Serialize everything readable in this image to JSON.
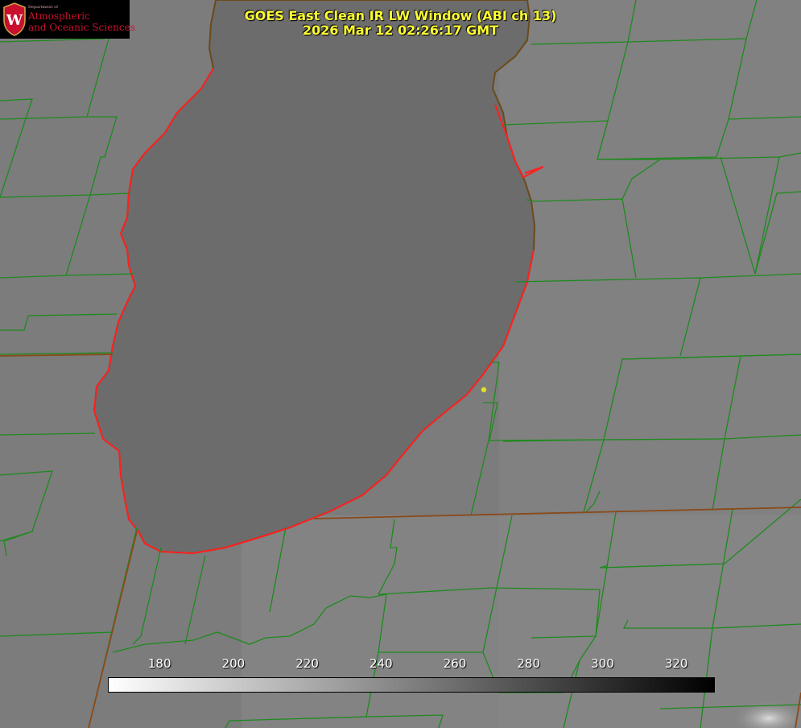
{
  "title": {
    "line1": "GOES East Clean IR LW Window (ABI ch 13)",
    "line2": "2026 Mar 12 02:26:17 GMT"
  },
  "logo": {
    "crest_letter": "W",
    "department": "Department of",
    "line1": "Atmospheric",
    "line2": "and Oceanic Sciences",
    "color": "#c8102e"
  },
  "colorbar": {
    "ticks": [
      "180",
      "200",
      "220",
      "240",
      "260",
      "280",
      "300",
      "320"
    ],
    "tick_values": [
      180,
      200,
      220,
      240,
      260,
      280,
      300,
      320
    ],
    "range": [
      166,
      330
    ],
    "colormap": "grayscale, white (cold) to black (warm)"
  },
  "colors": {
    "boundaries": "#1e8a1e",
    "lake_outline": "#ff2020",
    "title_text": "#ffff33",
    "station_marker": "#e0e020"
  }
}
